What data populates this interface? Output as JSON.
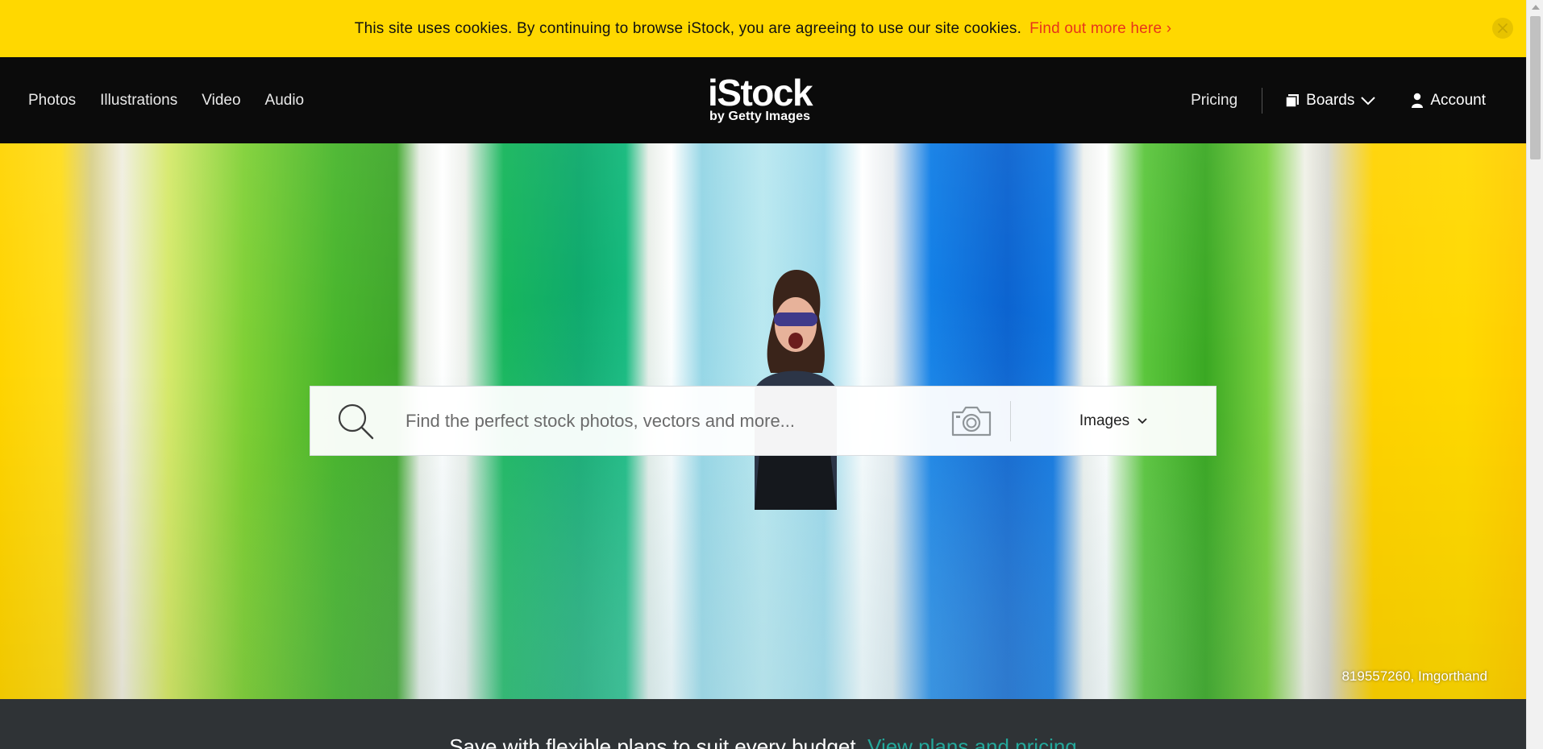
{
  "cookie_bar": {
    "message": "This site uses cookies. By continuing to browse iStock, you are agreeing to use our site cookies.",
    "link_text": "Find out more here ›",
    "close_icon": "close-icon"
  },
  "nav": {
    "left_items": [
      {
        "label": "Photos"
      },
      {
        "label": "Illustrations"
      },
      {
        "label": "Video"
      },
      {
        "label": "Audio"
      }
    ],
    "logo": {
      "main": "iStock",
      "sub": "by Getty Images"
    },
    "pricing": "Pricing",
    "boards": "Boards",
    "account": "Account"
  },
  "hero": {
    "credit": "819557260, Imgorthand"
  },
  "search": {
    "placeholder": "Find the perfect stock photos, vectors and more...",
    "value": "",
    "type_selected": "Images"
  },
  "promo": {
    "text": "Save with flexible plans to suit every budget.",
    "link_text": "View plans and pricing"
  },
  "colors": {
    "cookie_bg": "#ffd800",
    "cookie_link": "#e8341b",
    "nav_bg": "#0b0b0b",
    "promo_bg": "#2f3336",
    "promo_link": "#23a79a"
  }
}
